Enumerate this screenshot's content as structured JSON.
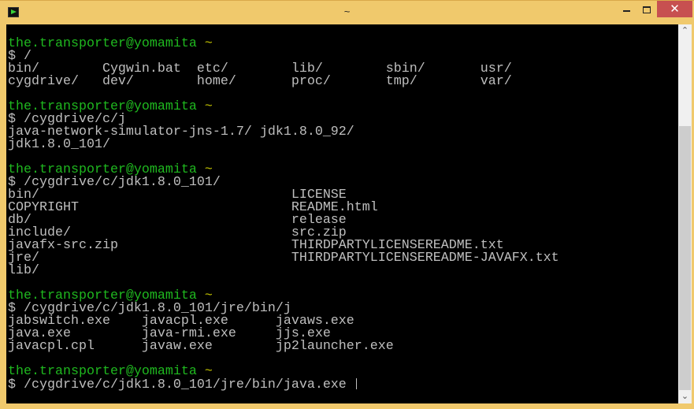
{
  "window": {
    "title": "~",
    "close_glyph": "✕",
    "scroll_up_glyph": "⌃",
    "scroll_down_glyph": "⌄"
  },
  "prompt": {
    "user": "the.transporter@yomamita",
    "cwd": "~"
  },
  "lines": [
    {
      "type": "blank",
      "text": ""
    },
    {
      "type": "prompt"
    },
    {
      "type": "out",
      "text": "$ /"
    },
    {
      "type": "out",
      "text": "bin/        Cygwin.bat  etc/        lib/        sbin/       usr/"
    },
    {
      "type": "out",
      "text": "cygdrive/   dev/        home/       proc/       tmp/        var/"
    },
    {
      "type": "blank",
      "text": ""
    },
    {
      "type": "prompt"
    },
    {
      "type": "out",
      "text": "$ /cygdrive/c/j"
    },
    {
      "type": "out",
      "text": "java-network-simulator-jns-1.7/ jdk1.8.0_92/"
    },
    {
      "type": "out",
      "text": "jdk1.8.0_101/"
    },
    {
      "type": "blank",
      "text": ""
    },
    {
      "type": "prompt"
    },
    {
      "type": "out",
      "text": "$ /cygdrive/c/jdk1.8.0_101/"
    },
    {
      "type": "out",
      "text": "bin/                                LICENSE"
    },
    {
      "type": "out",
      "text": "COPYRIGHT                           README.html"
    },
    {
      "type": "out",
      "text": "db/                                 release"
    },
    {
      "type": "out",
      "text": "include/                            src.zip"
    },
    {
      "type": "out",
      "text": "javafx-src.zip                      THIRDPARTYLICENSEREADME.txt"
    },
    {
      "type": "out",
      "text": "jre/                                THIRDPARTYLICENSEREADME-JAVAFX.txt"
    },
    {
      "type": "out",
      "text": "lib/"
    },
    {
      "type": "blank",
      "text": ""
    },
    {
      "type": "prompt"
    },
    {
      "type": "out",
      "text": "$ /cygdrive/c/jdk1.8.0_101/jre/bin/j"
    },
    {
      "type": "out",
      "text": "jabswitch.exe    javacpl.exe      javaws.exe"
    },
    {
      "type": "out",
      "text": "java.exe         java-rmi.exe     jjs.exe"
    },
    {
      "type": "out",
      "text": "javacpl.cpl      javaw.exe        jp2launcher.exe"
    },
    {
      "type": "blank",
      "text": ""
    },
    {
      "type": "prompt"
    },
    {
      "type": "input",
      "text": "$ /cygdrive/c/jdk1.8.0_101/jre/bin/java.exe "
    }
  ]
}
